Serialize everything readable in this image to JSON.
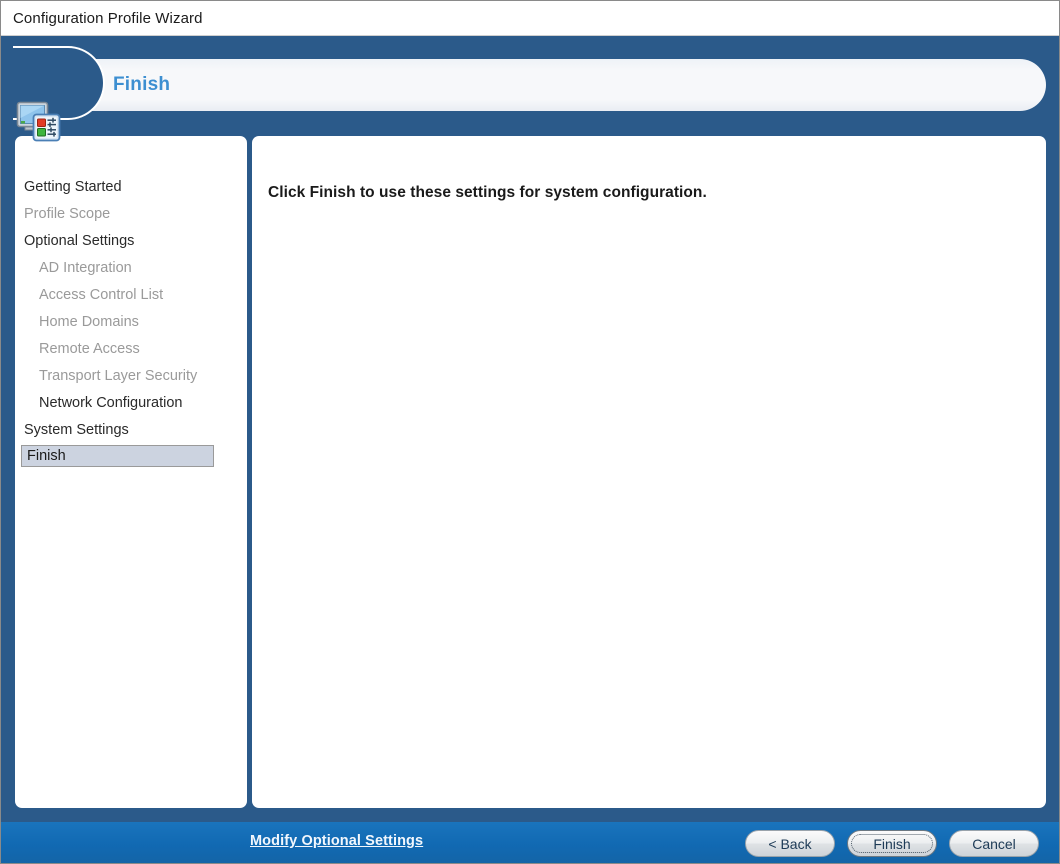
{
  "window": {
    "title": "Configuration Profile Wizard"
  },
  "header": {
    "title": "Finish",
    "icon": "system-configuration-icon"
  },
  "sidebar": {
    "items": [
      {
        "label": "Getting Started",
        "level": 0,
        "state": "active"
      },
      {
        "label": "Profile Scope",
        "level": 0,
        "state": "dim"
      },
      {
        "label": "Optional Settings",
        "level": 0,
        "state": "active"
      },
      {
        "label": "AD Integration",
        "level": 1,
        "state": "dim"
      },
      {
        "label": "Access Control List",
        "level": 1,
        "state": "dim"
      },
      {
        "label": "Home Domains",
        "level": 1,
        "state": "dim"
      },
      {
        "label": "Remote Access",
        "level": 1,
        "state": "dim"
      },
      {
        "label": "Transport Layer Security",
        "level": 1,
        "state": "dim"
      },
      {
        "label": "Network Configuration",
        "level": 1,
        "state": "active"
      },
      {
        "label": "System Settings",
        "level": 0,
        "state": "active"
      },
      {
        "label": "Finish",
        "level": 0,
        "state": "selected"
      }
    ]
  },
  "main": {
    "heading": "Click Finish to use these settings for system configuration."
  },
  "footer": {
    "link_label": "Modify Optional Settings",
    "back_label": "< Back",
    "finish_label": "Finish",
    "cancel_label": "Cancel"
  },
  "colors": {
    "header_blue": "#2b5a8a",
    "footer_blue": "#1169b2",
    "title_accent": "#3d8fd1",
    "selected_nav_bg": "#ccd3e0",
    "dim_text": "#9a9a9a"
  }
}
